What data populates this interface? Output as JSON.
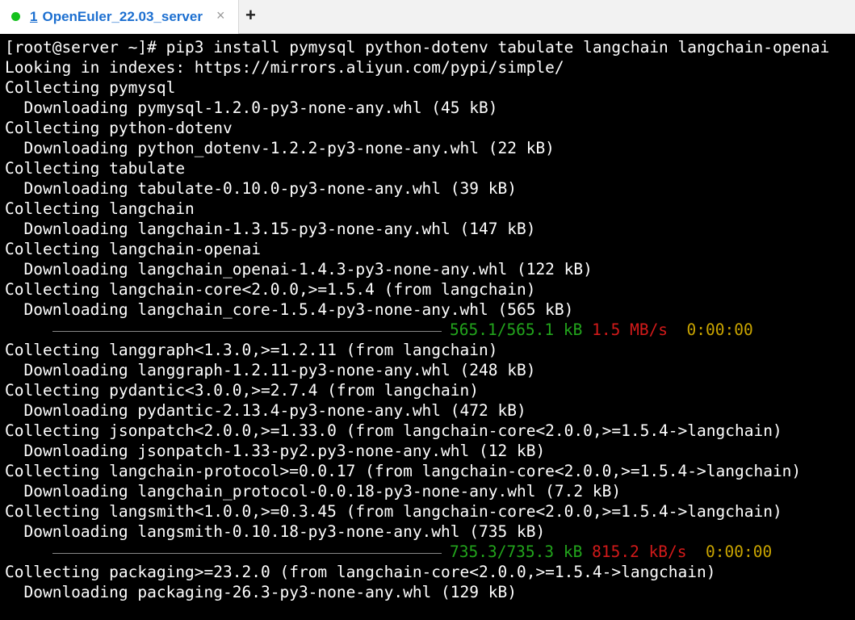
{
  "tabbar": {
    "tab": {
      "number": "1",
      "title": "OpenEuler_22.03_server",
      "close_glyph": "×",
      "status_color": "#14c11d"
    },
    "new_tab_glyph": "+"
  },
  "terminal": {
    "lines": [
      "[root@server ~]# pip3 install pymysql python-dotenv tabulate langchain langchain-openai",
      "Looking in indexes: https://mirrors.aliyun.com/pypi/simple/",
      "Collecting pymysql",
      "  Downloading pymysql-1.2.0-py3-none-any.whl (45 kB)",
      "Collecting python-dotenv",
      "  Downloading python_dotenv-1.2.2-py3-none-any.whl (22 kB)",
      "Collecting tabulate",
      "  Downloading tabulate-0.10.0-py3-none-any.whl (39 kB)",
      "Collecting langchain",
      "  Downloading langchain-1.3.15-py3-none-any.whl (147 kB)",
      "Collecting langchain-openai",
      "  Downloading langchain_openai-1.4.3-py3-none-any.whl (122 kB)",
      "Collecting langchain-core<2.0.0,>=1.5.4 (from langchain)",
      "  Downloading langchain_core-1.5.4-py3-none-any.whl (565 kB)",
      "",
      "Collecting langgraph<1.3.0,>=1.2.11 (from langchain)",
      "  Downloading langgraph-1.2.11-py3-none-any.whl (248 kB)",
      "Collecting pydantic<3.0.0,>=2.7.4 (from langchain)",
      "  Downloading pydantic-2.13.4-py3-none-any.whl (472 kB)",
      "Collecting jsonpatch<2.0.0,>=1.33.0 (from langchain-core<2.0.0,>=1.5.4->langchain)",
      "  Downloading jsonpatch-1.33-py2.py3-none-any.whl (12 kB)",
      "Collecting langchain-protocol>=0.0.17 (from langchain-core<2.0.0,>=1.5.4->langchain)",
      "  Downloading langchain_protocol-0.0.18-py3-none-any.whl (7.2 kB)",
      "Collecting langsmith<1.0.0,>=0.3.45 (from langchain-core<2.0.0,>=1.5.4->langchain)",
      "  Downloading langsmith-0.10.18-py3-none-any.whl (735 kB)",
      "",
      "Collecting packaging>=23.2.0 (from langchain-core<2.0.0,>=1.5.4->langchain)",
      "  Downloading packaging-26.3-py3-none-any.whl (129 kB)"
    ],
    "progress": [
      {
        "size": "565.1/565.1 kB",
        "speed": "1.5 MB/s",
        "eta": "0:00:00",
        "fraction": 1.0
      },
      {
        "size": "735.3/735.3 kB",
        "speed": "815.2 kB/s",
        "eta": "0:00:00",
        "fraction": 1.0
      }
    ]
  },
  "colors": {
    "background": "#000000",
    "text": "#ffffff",
    "size": "#22a51c",
    "speed": "#d31a1a",
    "eta": "#c9a400"
  }
}
